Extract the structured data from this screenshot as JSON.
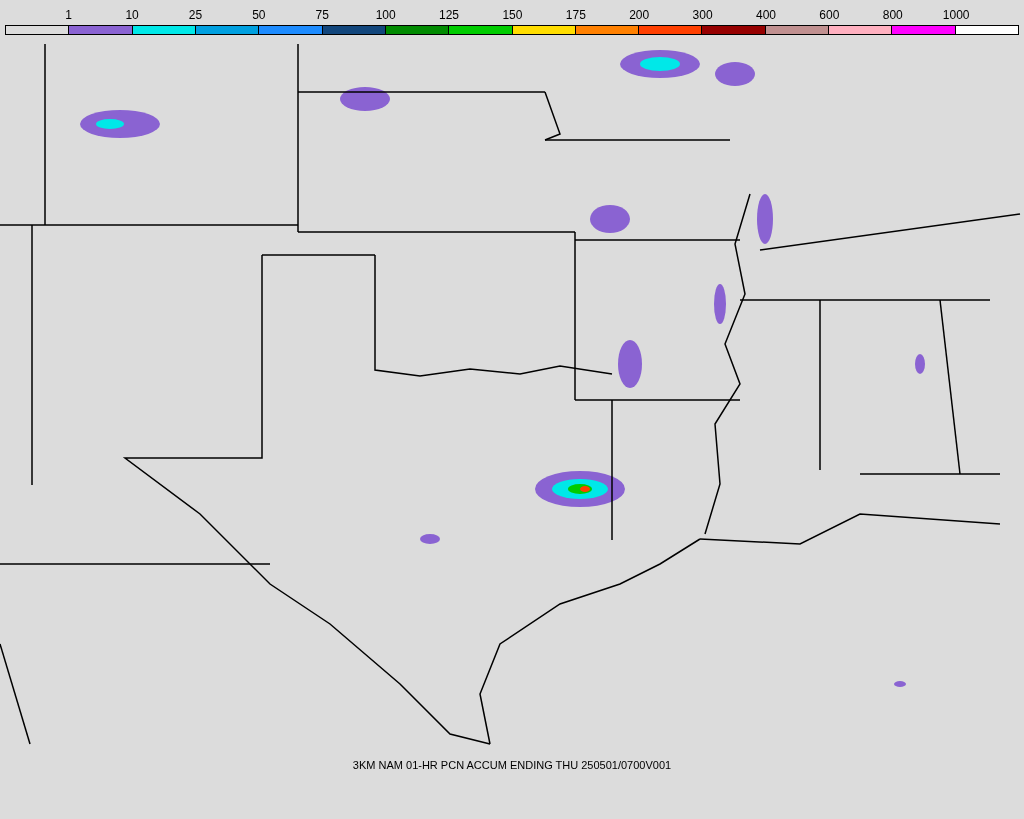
{
  "legend": {
    "labels": [
      "1",
      "10",
      "25",
      "50",
      "75",
      "100",
      "125",
      "150",
      "175",
      "200",
      "300",
      "400",
      "600",
      "800",
      "1000"
    ],
    "bins": [
      {
        "color": "#dcdcdc"
      },
      {
        "color": "#8a63d2"
      },
      {
        "color": "#00e8e8"
      },
      {
        "color": "#00a0e0"
      },
      {
        "color": "#1e8cff"
      },
      {
        "color": "#12467c"
      },
      {
        "color": "#008a00"
      },
      {
        "color": "#00cc00"
      },
      {
        "color": "#ffdd00"
      },
      {
        "color": "#ff8000"
      },
      {
        "color": "#ff4000"
      },
      {
        "color": "#960000"
      },
      {
        "color": "#c09090"
      },
      {
        "color": "#ffb0c0"
      },
      {
        "color": "#ff00ff"
      },
      {
        "color": "#ffffff"
      }
    ]
  },
  "caption": "3KM NAM 01-HR PCN ACCUM ENDING THU 250501/0700V001"
}
